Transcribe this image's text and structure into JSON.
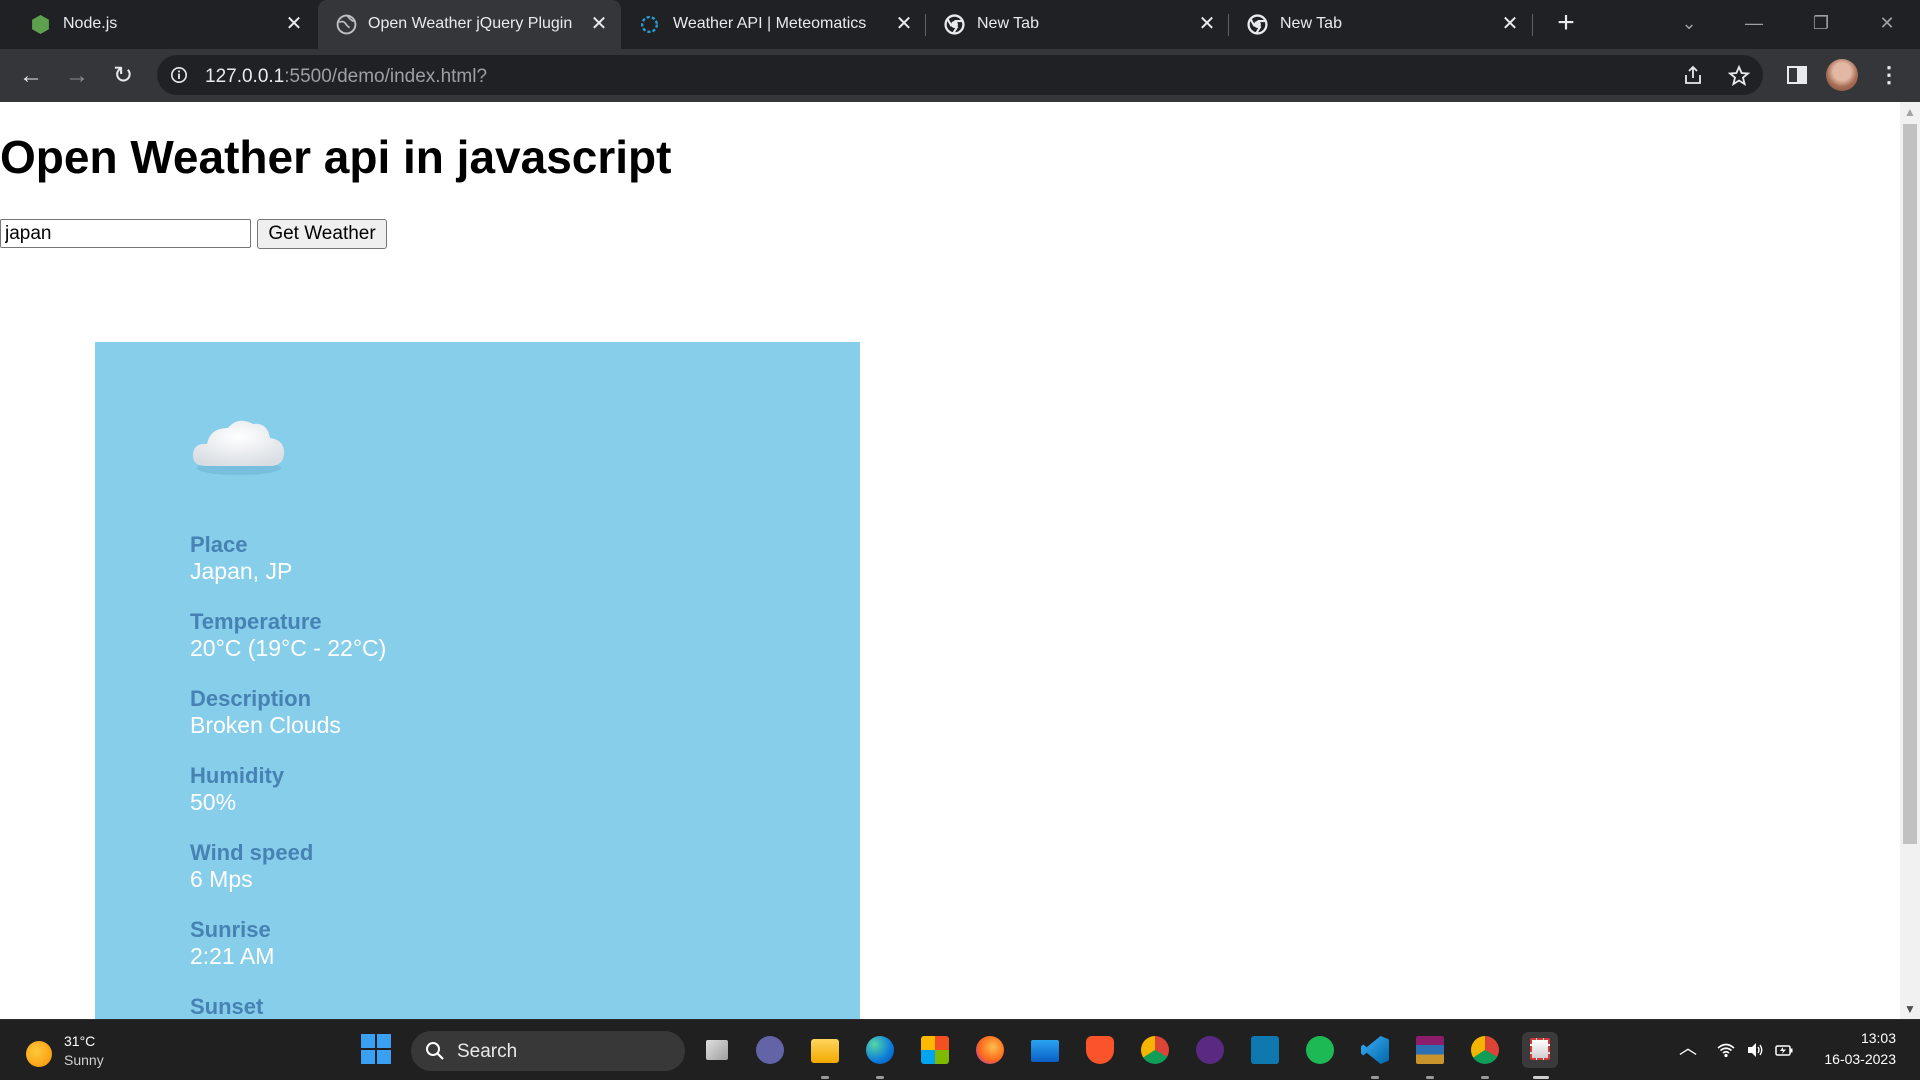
{
  "tabs": [
    {
      "title": "Node.js",
      "icon": "nodejs-icon",
      "active": false
    },
    {
      "title": "Open Weather jQuery Plugin",
      "icon": "globe-icon",
      "active": true
    },
    {
      "title": "Weather API | Meteomatics",
      "icon": "meteomatics-icon",
      "active": false
    },
    {
      "title": "New Tab",
      "icon": "chrome-icon",
      "active": false
    },
    {
      "title": "New Tab",
      "icon": "chrome-icon",
      "active": false
    }
  ],
  "address_bar": {
    "host": "127.0.0.1",
    "rest": ":5500/demo/index.html?"
  },
  "page": {
    "heading": "Open Weather api in javascript",
    "input_value": "japan",
    "button_label": "Get Weather"
  },
  "weather": {
    "fields": [
      {
        "label": "Place",
        "value": "Japan, JP"
      },
      {
        "label": "Temperature",
        "value": "20°C (19°C - 22°C)"
      },
      {
        "label": "Description",
        "value": "Broken Clouds"
      },
      {
        "label": "Humidity",
        "value": "50%"
      },
      {
        "label": "Wind speed",
        "value": "6 Mps"
      },
      {
        "label": "Sunrise",
        "value": "2:21 AM"
      },
      {
        "label": "Sunset",
        "value": ""
      }
    ],
    "card_color": "#87ceeb",
    "label_color": "#4682b4"
  },
  "taskbar": {
    "widget_temp": "31°C",
    "widget_condition": "Sunny",
    "search_label": "Search",
    "clock_time": "13:03",
    "clock_date": "16-03-2023"
  }
}
